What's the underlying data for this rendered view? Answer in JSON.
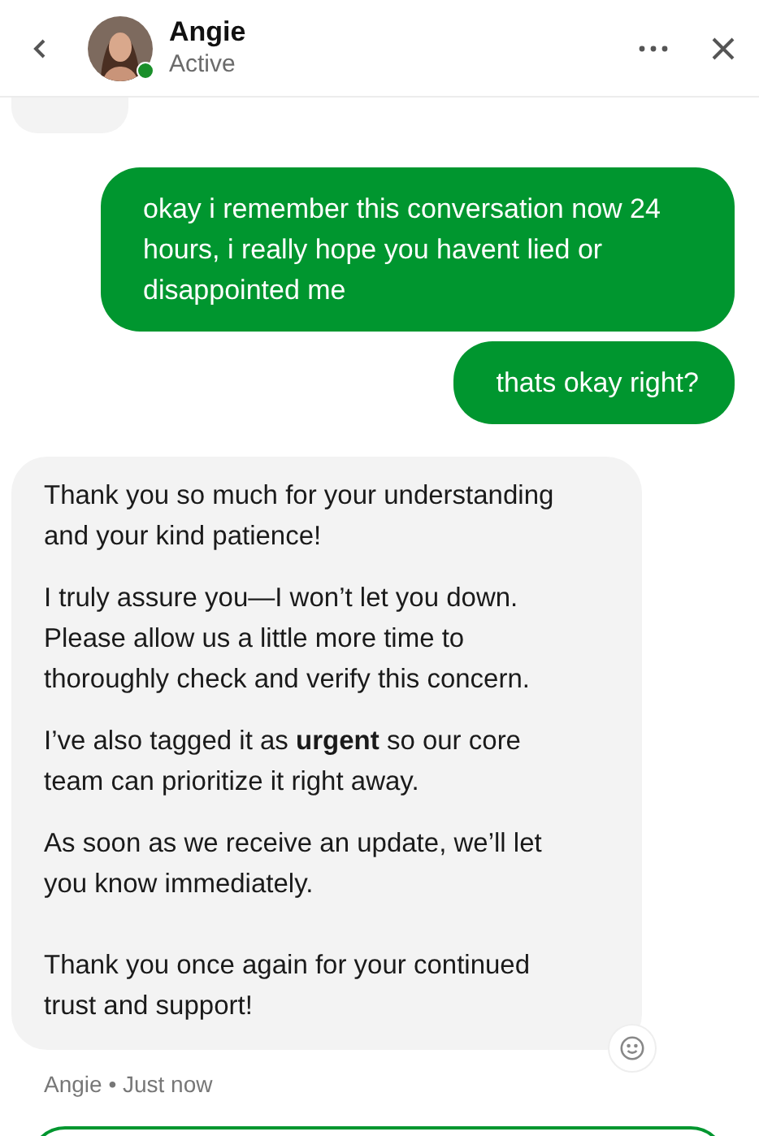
{
  "header": {
    "name": "Angie",
    "status": "Active",
    "online": true
  },
  "messages": [
    {
      "kind": "incoming_cut"
    },
    {
      "kind": "outgoing",
      "text": "okay i remember this conversation now 24 hours, i really hope you havent lied or disappointed me"
    },
    {
      "kind": "outgoing",
      "text": "thats okay right?"
    },
    {
      "kind": "incoming",
      "paragraphs": [
        {
          "kind": "paragraph",
          "text": "Thank you so much for your understanding and your kind patience!"
        },
        {
          "kind": "paragraph",
          "text": "I truly assure you—I won’t let you down. Please allow us a little more time to thoroughly check and verify this concern."
        },
        {
          "kind": "paragraph",
          "text": "I’ve also tagged it as **urgent** so our core team can prioritize it right away."
        },
        {
          "kind": "paragraph",
          "text": "As soon as we receive an update, we’ll let you know immediately."
        },
        {
          "kind": "blank_line"
        },
        {
          "kind": "paragraph",
          "text": "Thank you once again for your continued trust and support!"
        }
      ],
      "meta": "Angie • Just now"
    }
  ]
}
